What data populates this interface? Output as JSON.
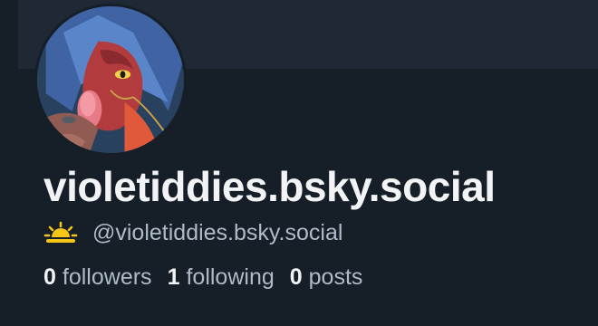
{
  "profile": {
    "display_name": "violetiddies.bsky.social",
    "status_emoji": "sun-behind-cloud-icon",
    "handle": "@violetiddies.bsky.social",
    "avatar_icon": "avatar-image"
  },
  "stats": {
    "followers_count": "0",
    "followers_label": "followers",
    "following_count": "1",
    "following_label": "following",
    "posts_count": "0",
    "posts_label": "posts"
  },
  "colors": {
    "background": "#161e27",
    "banner": "#1e2935",
    "primary_text": "#f1f3f5",
    "secondary_text": "#aebbc9",
    "emoji_sun": "#f5c518"
  }
}
